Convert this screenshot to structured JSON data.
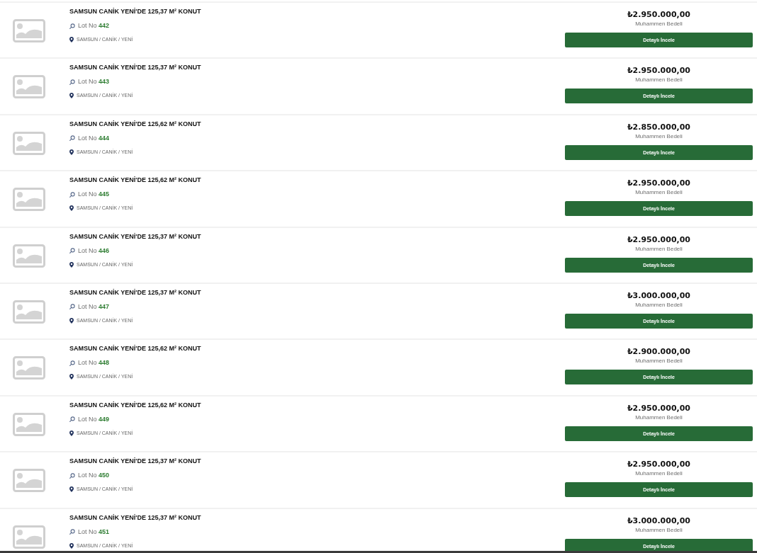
{
  "listings": [
    {
      "title": "SAMSUN CANİK YENİ'DE 125,37 M² KONUT",
      "lot_label": "Lot No",
      "lot_number": "442",
      "location": "SAMSUN / CANİK / YENİ",
      "price": "₺2.950.000,00",
      "price_label": "Muhammen Bedeli",
      "button": "Detaylı İncele"
    },
    {
      "title": "SAMSUN CANİK YENİ'DE 125,37 M² KONUT",
      "lot_label": "Lot No",
      "lot_number": "443",
      "location": "SAMSUN / CANİK / YENİ",
      "price": "₺2.950.000,00",
      "price_label": "Muhammen Bedeli",
      "button": "Detaylı İncele"
    },
    {
      "title": "SAMSUN CANİK YENİ'DE 125,62 M² KONUT",
      "lot_label": "Lot No",
      "lot_number": "444",
      "location": "SAMSUN / CANİK / YENİ",
      "price": "₺2.850.000,00",
      "price_label": "Muhammen Bedeli",
      "button": "Detaylı İncele"
    },
    {
      "title": "SAMSUN CANİK YENİ'DE 125,62 M² KONUT",
      "lot_label": "Lot No",
      "lot_number": "445",
      "location": "SAMSUN / CANİK / YENİ",
      "price": "₺2.950.000,00",
      "price_label": "Muhammen Bedeli",
      "button": "Detaylı İncele"
    },
    {
      "title": "SAMSUN CANİK YENİ'DE 125,37 M² KONUT",
      "lot_label": "Lot No",
      "lot_number": "446",
      "location": "SAMSUN / CANİK / YENİ",
      "price": "₺2.950.000,00",
      "price_label": "Muhammen Bedeli",
      "button": "Detaylı İncele"
    },
    {
      "title": "SAMSUN CANİK YENİ'DE 125,37 M² KONUT",
      "lot_label": "Lot No",
      "lot_number": "447",
      "location": "SAMSUN / CANİK / YENİ",
      "price": "₺3.000.000,00",
      "price_label": "Muhammen Bedeli",
      "button": "Detaylı İncele"
    },
    {
      "title": "SAMSUN CANİK YENİ'DE 125,62 M² KONUT",
      "lot_label": "Lot No",
      "lot_number": "448",
      "location": "SAMSUN / CANİK / YENİ",
      "price": "₺2.900.000,00",
      "price_label": "Muhammen Bedeli",
      "button": "Detaylı İncele"
    },
    {
      "title": "SAMSUN CANİK YENİ'DE 125,62 M² KONUT",
      "lot_label": "Lot No",
      "lot_number": "449",
      "location": "SAMSUN / CANİK / YENİ",
      "price": "₺2.950.000,00",
      "price_label": "Muhammen Bedeli",
      "button": "Detaylı İncele"
    },
    {
      "title": "SAMSUN CANİK YENİ'DE 125,37 M² KONUT",
      "lot_label": "Lot No",
      "lot_number": "450",
      "location": "SAMSUN / CANİK / YENİ",
      "price": "₺2.950.000,00",
      "price_label": "Muhammen Bedeli",
      "button": "Detaylı İncele"
    },
    {
      "title": "SAMSUN CANİK YENİ'DE 125,37 M² KONUT",
      "lot_label": "Lot No",
      "lot_number": "451",
      "location": "SAMSUN / CANİK / YENİ",
      "price": "₺3.000.000,00",
      "price_label": "Muhammen Bedeli",
      "button": "Detaylı İncele"
    }
  ]
}
